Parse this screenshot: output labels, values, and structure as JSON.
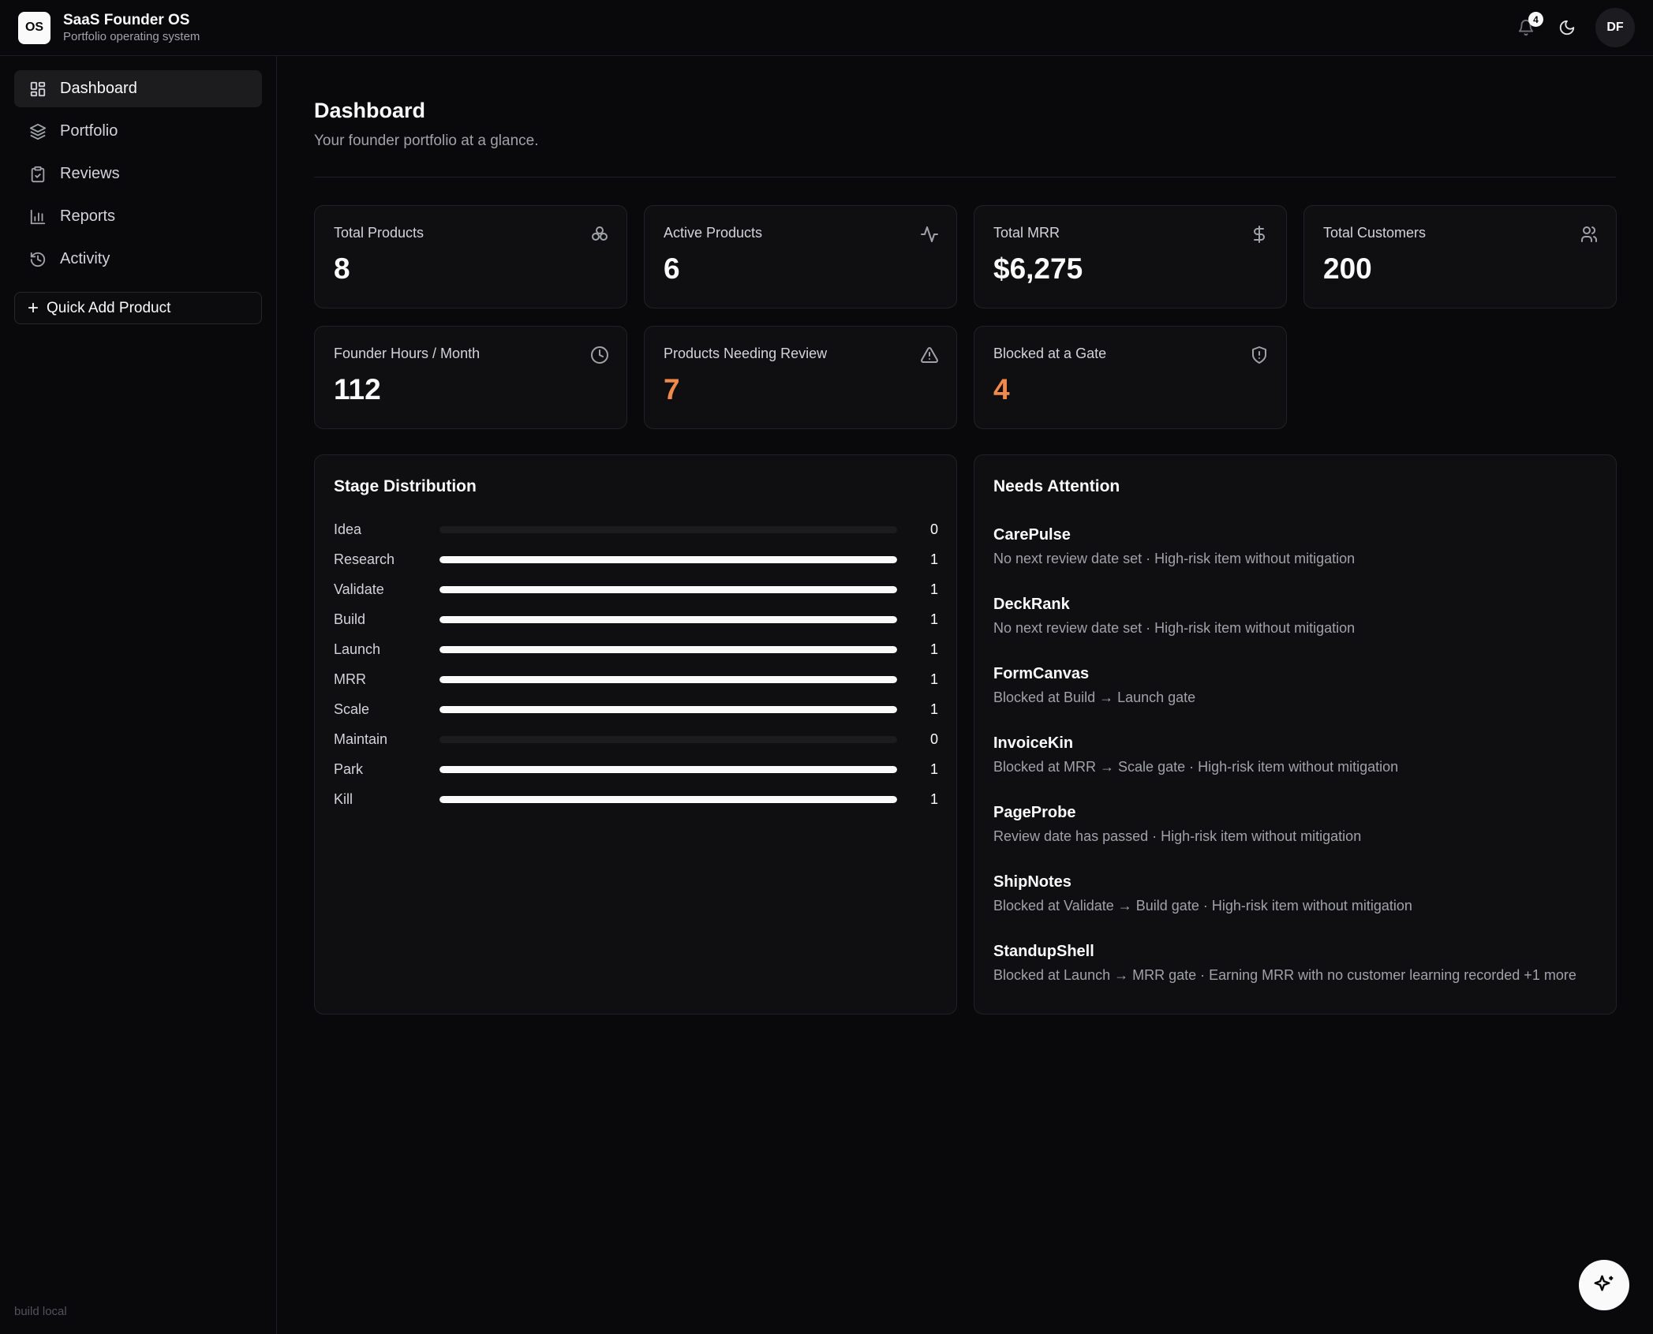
{
  "app": {
    "logo_text": "OS",
    "title": "SaaS Founder OS",
    "subtitle": "Portfolio operating system",
    "notification_count": "4",
    "avatar_initials": "DF"
  },
  "sidebar": {
    "items": [
      {
        "label": "Dashboard",
        "icon": "dashboard-icon",
        "active": true
      },
      {
        "label": "Portfolio",
        "icon": "layers-icon"
      },
      {
        "label": "Reviews",
        "icon": "clipboard-check-icon"
      },
      {
        "label": "Reports",
        "icon": "bar-chart-icon"
      },
      {
        "label": "Activity",
        "icon": "history-icon"
      }
    ],
    "quick_add_label": "Quick Add Product",
    "build_label": "build local"
  },
  "page": {
    "title": "Dashboard",
    "subtitle": "Your founder portfolio at a glance."
  },
  "stats": [
    {
      "label": "Total Products",
      "value": "8",
      "icon": "boxes-icon"
    },
    {
      "label": "Active Products",
      "value": "6",
      "icon": "activity-icon"
    },
    {
      "label": "Total MRR",
      "value": "$6,275",
      "icon": "dollar-icon"
    },
    {
      "label": "Total Customers",
      "value": "200",
      "icon": "users-icon"
    },
    {
      "label": "Founder Hours / Month",
      "value": "112",
      "icon": "clock-icon"
    },
    {
      "label": "Products Needing Review",
      "value": "7",
      "icon": "alert-triangle-icon",
      "warn": true
    },
    {
      "label": "Blocked at a Gate",
      "value": "4",
      "icon": "shield-alert-icon",
      "warn": true
    }
  ],
  "stage_distribution": {
    "title": "Stage Distribution",
    "max": 1,
    "rows": [
      {
        "label": "Idea",
        "count": 0
      },
      {
        "label": "Research",
        "count": 1
      },
      {
        "label": "Validate",
        "count": 1
      },
      {
        "label": "Build",
        "count": 1
      },
      {
        "label": "Launch",
        "count": 1
      },
      {
        "label": "MRR",
        "count": 1
      },
      {
        "label": "Scale",
        "count": 1
      },
      {
        "label": "Maintain",
        "count": 0
      },
      {
        "label": "Park",
        "count": 1
      },
      {
        "label": "Kill",
        "count": 1
      }
    ]
  },
  "needs_attention": {
    "title": "Needs Attention",
    "items": [
      {
        "name": "CarePulse",
        "desc": "No next review date set · High-risk item without mitigation"
      },
      {
        "name": "DeckRank",
        "desc": "No next review date set · High-risk item without mitigation"
      },
      {
        "name": "FormCanvas",
        "desc": "Blocked at Build → Launch gate"
      },
      {
        "name": "InvoiceKin",
        "desc": "Blocked at MRR → Scale gate · High-risk item without mitigation"
      },
      {
        "name": "PageProbe",
        "desc": "Review date has passed · High-risk item without mitigation"
      },
      {
        "name": "ShipNotes",
        "desc": "Blocked at Validate → Build gate · High-risk item without mitigation"
      },
      {
        "name": "StandupShell",
        "desc": "Blocked at Launch → MRR gate · Earning MRR with no customer learning recorded +1 more"
      }
    ]
  },
  "colors": {
    "background": "#09090b",
    "card": "#0f0f11",
    "warn": "#f08a4b",
    "text": "#fafafa",
    "muted": "#a1a1aa"
  }
}
